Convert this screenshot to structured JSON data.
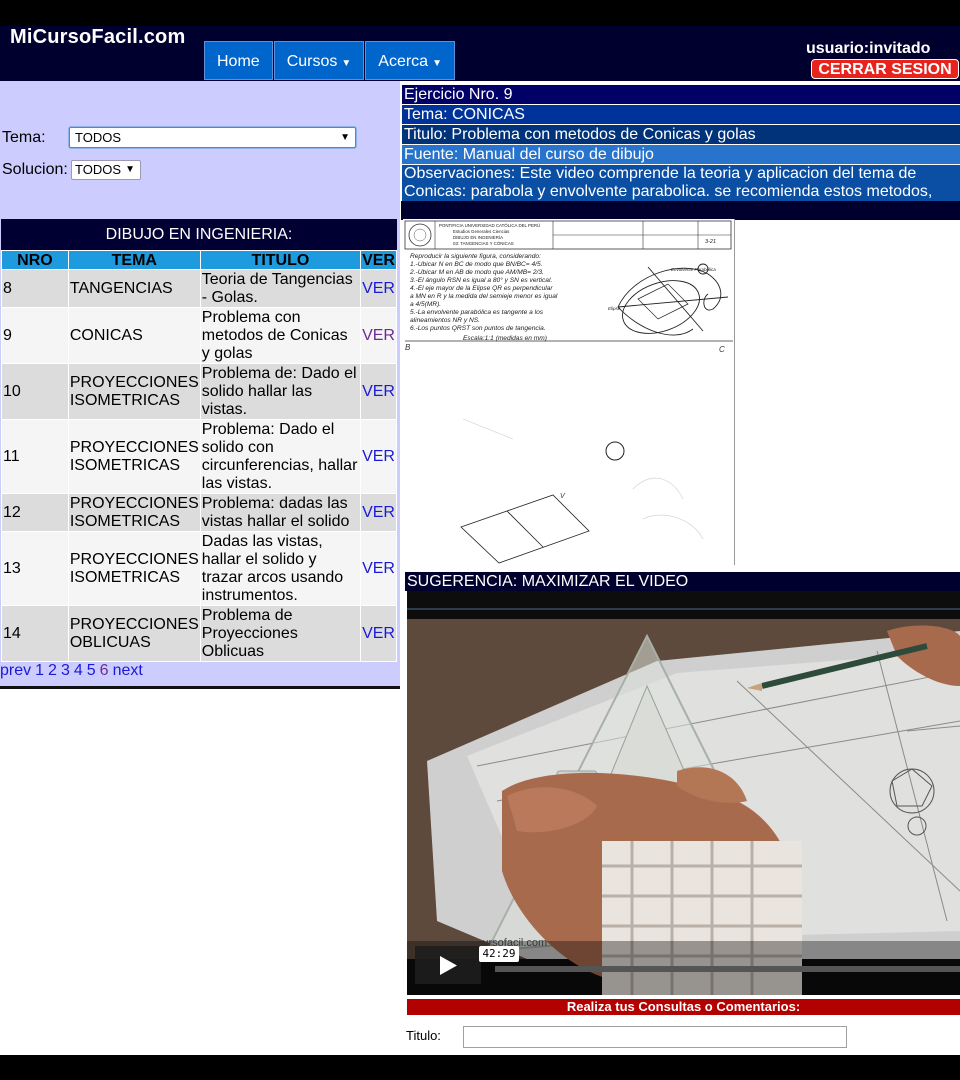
{
  "header": {
    "site_name": "MiCursoFacil.com",
    "nav": [
      {
        "label": "Home",
        "dropdown": false
      },
      {
        "label": "Cursos",
        "dropdown": true
      },
      {
        "label": "Acerca",
        "dropdown": true
      }
    ],
    "user_label": "usuario:invitado",
    "logout_label": "CERRAR SESION"
  },
  "filters": {
    "tema_label": "Tema:",
    "tema_value": "TODOS",
    "solucion_label": "Solucion:",
    "solucion_value": "TODOS"
  },
  "table": {
    "title": "DIBUJO EN INGENIERIA:",
    "headers": [
      "NRO",
      "TEMA",
      "TITULO",
      "VER"
    ],
    "rows": [
      {
        "nro": "8",
        "tema": "TANGENCIAS",
        "titulo": "Teoria de Tangencias - Golas.",
        "ver": "VER"
      },
      {
        "nro": "9",
        "tema": "CONICAS",
        "titulo": "Problema con metodos de Conicas y golas",
        "ver": "VER"
      },
      {
        "nro": "10",
        "tema": "PROYECCIONES ISOMETRICAS",
        "titulo": "Problema de: Dado el solido hallar las vistas.",
        "ver": "VER"
      },
      {
        "nro": "11",
        "tema": "PROYECCIONES ISOMETRICAS",
        "titulo": "Problema: Dado el solido con circunferencias, hallar las vistas.",
        "ver": "VER"
      },
      {
        "nro": "12",
        "tema": "PROYECCIONES ISOMETRICAS",
        "titulo": "Problema: dadas las vistas hallar el solido",
        "ver": "VER"
      },
      {
        "nro": "13",
        "tema": "PROYECCIONES ISOMETRICAS",
        "titulo": "Dadas las vistas, hallar el solido y trazar arcos usando instrumentos.",
        "ver": "VER"
      },
      {
        "nro": "14",
        "tema": "PROYECCIONES OBLICUAS",
        "titulo": "Problema de Proyecciones Oblicuas",
        "ver": "VER"
      }
    ]
  },
  "pagination": {
    "prev": "prev",
    "pages": [
      "1",
      "2",
      "3",
      "4",
      "5",
      "6"
    ],
    "next": "next"
  },
  "exercise": {
    "ejercicio": "Ejercicio Nro. 9",
    "tema": "Tema: CONICAS",
    "titulo": "Titulo: Problema con metodos de Conicas y golas",
    "fuente": "Fuente: Manual del curso de dibujo",
    "observaciones": "Observaciones: Este video comprende la teoria y aplicacion del tema de Conicas: parabola y envolvente parabolica. se recomienda estos metodos, son los mas"
  },
  "sheet": {
    "header_text": "PONTIFICIA UNIVERSIDAD CATÓLICA DEL PERÚ",
    "subheader_text": "Estudios Generales Ciencias",
    "course_text": "DIBUJO EN INGENIERÍA",
    "topic_text": "03: TANGENCIAS Y CÓNICAS",
    "sheet_number": "3-21",
    "instructions": [
      "Reproducir la siguiente figura, considerando:",
      "1.-Ubicar N en BC de modo que BN/BC= 4/5.",
      "2.-Ubicar M en AB de modo que AM/MB= 2/3.",
      "3.-El ángulo RSN es igual a 80° y SN es vertical.",
      "4.-El eje mayor de la Elipse QR es perpendicular",
      "    a MN en R y la medida del semieje menor es igual",
      "    a 4/5(MR).",
      "5.-La envolvente parabólica es tangente a los",
      "    alineamientos NR y NS.",
      "6.-Los puntos QRST son puntos de tangencia.",
      "Escala:1:1 (medidas en mm)"
    ],
    "label_b": "B",
    "label_c": "C",
    "label_v": "V",
    "label_envolvente": "Envolvente Parabólica",
    "label_elipse": "Elipse"
  },
  "video": {
    "suggestion": "SUGERENCIA: MAXIMIZAR EL VIDEO",
    "time": "42:29",
    "watermark": "www.micursofacil.com"
  },
  "comments": {
    "title": "Realiza tus Consultas o Comentarios:",
    "titulo_label": "Titulo:"
  }
}
